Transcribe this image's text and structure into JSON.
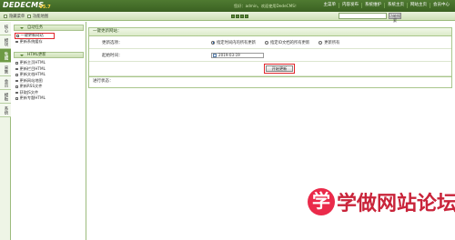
{
  "header": {
    "logo": "DEDECMS",
    "version": "V5.7",
    "welcome": "您好：admin，欢迎使用DedeCMS！",
    "nav": [
      "主菜单",
      "内容发布",
      "系统维护",
      "系统主页",
      "网站主页",
      "会员中心"
    ]
  },
  "subbar": {
    "link1": "隐藏菜单",
    "link2": "功能地图",
    "search_placeholder": "",
    "search_value": "",
    "search_button": "功能搜索"
  },
  "vtabs": [
    "核心",
    "模块",
    "生成",
    "采集",
    "会员",
    "模板",
    "系统"
  ],
  "sidebar": {
    "group1": "自动任务",
    "group1_items": [
      "一键更新网站",
      "更新系统缓存"
    ],
    "group2": "HTML更新",
    "group2_items": [
      "更新主页HTML",
      "更新栏目HTML",
      "更新文档HTML",
      "更新网站地图",
      "更新RSS文件",
      "获取JS文件",
      "更新专题HTML"
    ]
  },
  "main": {
    "panel_title": "一键更新网站：",
    "update_options_label": "更新选项：",
    "options": [
      "指定时间内的所有更新",
      "指定ID文档的所有更新",
      "更新所有"
    ],
    "start_time_label": "起始时间：",
    "start_time_value": "2019-03-19",
    "start_button": "开始更新",
    "progress_label": "进行状态："
  },
  "watermark": {
    "circle": "学",
    "text": "学做网站论坛"
  },
  "colors": {
    "header_green": "#3b6122",
    "highlight_red": "#e0262b",
    "watermark_red": "#ea2a4a"
  }
}
